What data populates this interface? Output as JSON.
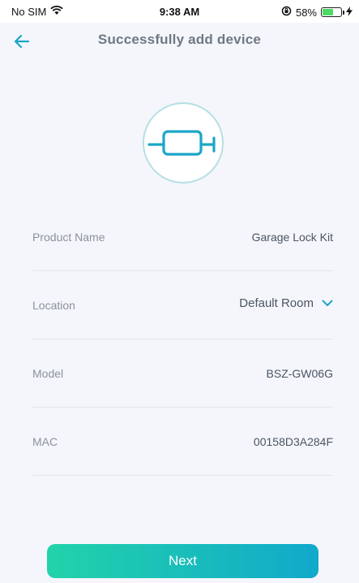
{
  "status_bar": {
    "carrier": "No SIM",
    "time": "9:38 AM",
    "battery_percent": "58%",
    "battery_level": 0.58
  },
  "header": {
    "title": "Successfully add device"
  },
  "device": {
    "icon": "garage-lock-kit-icon"
  },
  "info": {
    "product_name_label": "Product Name",
    "product_name_value": "Garage Lock Kit",
    "location_label": "Location",
    "location_value": "Default Room",
    "model_label": "Model",
    "model_value": "BSZ-GW06G",
    "mac_label": "MAC",
    "mac_value": "00158D3A284F"
  },
  "actions": {
    "next_label": "Next"
  },
  "colors": {
    "accent": "#1aa6c7",
    "gradient_start": "#22d3a9",
    "gradient_end": "#11a9cb"
  }
}
